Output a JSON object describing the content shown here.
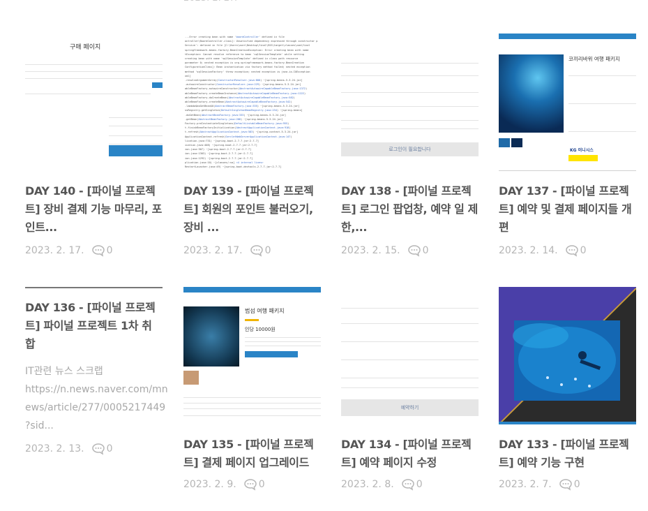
{
  "posts": [
    {
      "title": "DAY 140 - [파이널 프로젝트] 장비 결제 기능 마무리, 포인트...",
      "title_lines": [
        "DAY 140 - [파이널 프로젝",
        "트] 장비 결제 기능 마무리, 포",
        "인트..."
      ],
      "date": "2023. 2. 17.",
      "comments": "0"
    },
    {
      "title": "DAY 139 - [파이널 프로젝트] 회원의 포인트 불러오기, 장비 ...",
      "title_lines": [
        "DAY 139 - [파이널 프로젝",
        "트] 회원의 포인트 불러오기,",
        "장비 ..."
      ],
      "date": "2023. 2. 17.",
      "comments": "0"
    },
    {
      "title": "DAY 138 - [파이널 프로젝트] 로그인 팝업창, 예약 일 제한,...",
      "title_lines": [
        "DAY 138 - [파이널 프로젝",
        "트] 로그인 팝업창, 예약 일 제",
        "한,..."
      ],
      "date": "2023. 2. 15.",
      "comments": "0"
    },
    {
      "title": "DAY 137 - [파이널 프로젝트] 예약 및 결제 페이지들 개편",
      "title_lines": [
        "DAY 137 - [파이널 프로젝",
        "트] 예약 및 결제 페이지들 개",
        "편"
      ],
      "date": "2023. 2. 14.",
      "comments": "0"
    },
    {
      "title": "DAY 136 - [파이널 프로젝트] 파이널 프로젝트 1차 취합",
      "title_lines": [
        "DAY 136 - [파이널 프로젝",
        "트] 파이널 프로젝트 1차 취",
        "합"
      ],
      "summary_lines": [
        "IT관련 뉴스 스크랩",
        "https://n.news.naver.com/mn",
        "ews/article/277/0005217449",
        "?sid..."
      ],
      "date": "2023. 2. 13.",
      "comments": "0"
    },
    {
      "title": "DAY 135 - [파이널 프로젝트] 결제 페이지 업그레이드",
      "title_lines": [
        "DAY 135 - [파이널 프로젝",
        "트] 결제 페이지 업그레이드"
      ],
      "date": "2023. 2. 9.",
      "comments": "0"
    },
    {
      "title": "DAY 134 - [파이널 프로젝트] 예약 페이지 수정",
      "title_lines": [
        "DAY 134 - [파이널 프로젝",
        "트] 예약 페이지 수정"
      ],
      "date": "2023. 2. 8.",
      "comments": "0"
    },
    {
      "title": "DAY 133 - [파이널 프로젝트] 예약 기능 구현",
      "title_lines": [
        "DAY 133 - [파이널 프로젝",
        "트] 예약 기능 구현"
      ],
      "date": "2023. 2. 7.",
      "comments": "0"
    }
  ],
  "thumbs": {
    "t140": {
      "heading": "구매 페이지"
    },
    "t138": {
      "button": "로그인이 필요합니다"
    },
    "t137": {
      "heading": "코끼리바위 여행 패키지",
      "brand": "KG 이니시스"
    },
    "t135": {
      "heading": "범섬 여행 패키지",
      "price": "인당 10000원"
    },
    "t134": {
      "button": "예약하기"
    }
  },
  "colors": {
    "accent_blue": "#2a84c6",
    "title": "#555555",
    "meta": "#b5b5b5"
  }
}
